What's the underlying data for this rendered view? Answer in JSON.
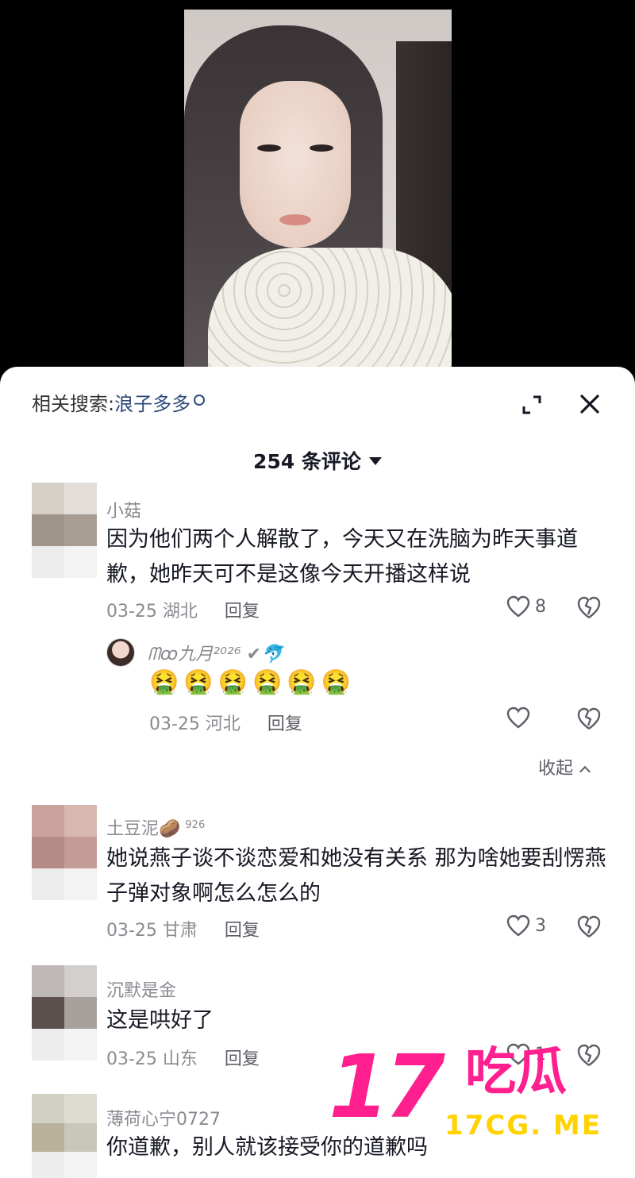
{
  "related": {
    "prefix": "相关搜索:",
    "keyword": "浪子多多"
  },
  "comments_count": "254 条评论",
  "comments": [
    {
      "name": "小菇",
      "text": "因为他们两个人解散了，今天又在洗脑为昨天事道歉，她昨天可不是这像今天开播这样说",
      "date_loc": "03-25 湖北",
      "reply": "回复",
      "likes": "8"
    },
    {
      "name": "土豆泥🥔",
      "badge": "926",
      "text": "她说燕子谈不谈恋爱和她没有关系 那为啥她要刮愣燕子弹对象啊怎么怎么的",
      "date_loc": "03-25 甘肃",
      "reply": "回复",
      "likes": "3"
    },
    {
      "name": "沉默是金",
      "text": "这是哄好了",
      "date_loc": "03-25 山东",
      "reply": "回复",
      "likes": "1"
    },
    {
      "name": "薄荷心宁0727",
      "text": "你道歉，别人就该接受你的道歉吗"
    }
  ],
  "sub_reply": {
    "name": "ᗰꝏ九月²⁰²⁶ ✔🐬",
    "emojis": "🤮🤮🤮🤮🤮🤮",
    "date_loc": "03-25 河北",
    "reply": "回复"
  },
  "collapse_label": "收起",
  "watermark": {
    "number": "17",
    "chinese": "吃瓜",
    "url": "17CG. ME"
  },
  "colors": {
    "watermark_pink": "#ff1f8f",
    "watermark_yellow": "#ffd200",
    "link_blue": "#2f4a7a"
  }
}
